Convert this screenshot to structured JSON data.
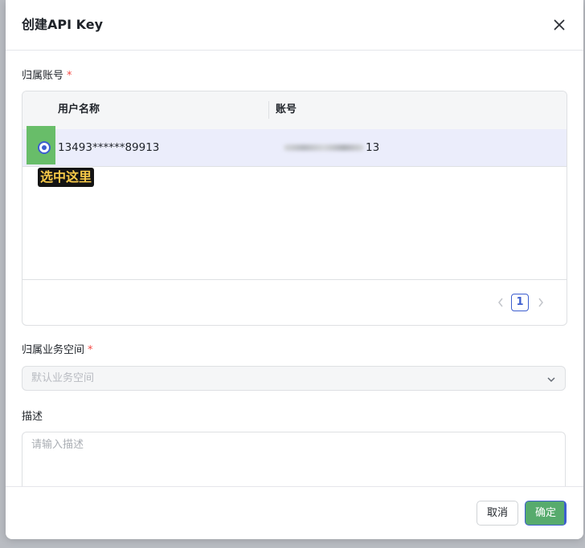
{
  "dialog": {
    "title": "创建API Key"
  },
  "owner_account": {
    "label": "归属账号",
    "required_mark": "*",
    "table": {
      "columns": [
        "用户名称",
        "账号"
      ],
      "rows": [
        {
          "username": "13493******89913",
          "account_suffix": "13",
          "selected": true
        }
      ]
    },
    "annotation": "选中这里",
    "pagination": {
      "current_page": "1"
    }
  },
  "workspace": {
    "label": "归属业务空间",
    "required_mark": "*",
    "placeholder": "默认业务空间"
  },
  "description": {
    "label": "描述",
    "placeholder": "请输入描述"
  },
  "footer": {
    "cancel_label": "取消",
    "confirm_label": "确定"
  },
  "colors": {
    "accent": "#3d5ecf",
    "required": "#f54a45",
    "annotation_highlight": "#5cb85c",
    "annotation_text": "#f7c948"
  }
}
